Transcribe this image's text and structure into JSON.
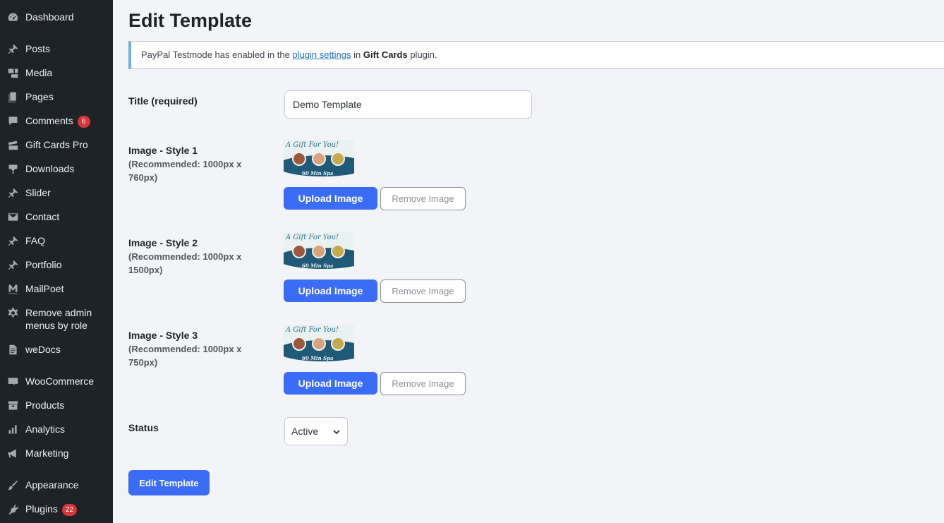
{
  "sidebar": {
    "items": [
      {
        "label": "Dashboard",
        "icon": "dashboard-icon"
      },
      {
        "label": "Posts",
        "icon": "pin-icon"
      },
      {
        "label": "Media",
        "icon": "media-icon"
      },
      {
        "label": "Pages",
        "icon": "pages-icon"
      },
      {
        "label": "Comments",
        "icon": "comment-icon",
        "badge": "6"
      },
      {
        "label": "Gift Cards Pro",
        "icon": "gift-cards-icon"
      },
      {
        "label": "Downloads",
        "icon": "download-icon"
      },
      {
        "label": "Slider",
        "icon": "pin-icon"
      },
      {
        "label": "Contact",
        "icon": "mail-icon"
      },
      {
        "label": "FAQ",
        "icon": "pin-icon"
      },
      {
        "label": "Portfolio",
        "icon": "pin-icon"
      },
      {
        "label": "MailPoet",
        "icon": "mailpoet-icon"
      },
      {
        "label": "Remove admin menus by role",
        "icon": "gear-icon"
      },
      {
        "label": "weDocs",
        "icon": "document-icon"
      },
      {
        "label": "WooCommerce",
        "icon": "woocommerce-icon"
      },
      {
        "label": "Products",
        "icon": "archive-icon"
      },
      {
        "label": "Analytics",
        "icon": "bar-chart-icon"
      },
      {
        "label": "Marketing",
        "icon": "megaphone-icon"
      },
      {
        "label": "Appearance",
        "icon": "brush-icon"
      },
      {
        "label": "Plugins",
        "icon": "plugin-icon",
        "badge": "22"
      }
    ]
  },
  "page": {
    "title": "Edit Template"
  },
  "notice": {
    "text_before": "PayPal Testmode has enabled in the ",
    "link": "plugin settings",
    "text_middle": " in ",
    "bold": "Gift Cards",
    "text_after": " plugin."
  },
  "form": {
    "title_label": "Title (required)",
    "title_value": "Demo Template",
    "images": [
      {
        "label": "Image - Style 1",
        "recommendation": "(Recommended: 1000px x 760px)"
      },
      {
        "label": "Image - Style 2",
        "recommendation": "(Recommended: 1000px x 1500px)"
      },
      {
        "label": "Image - Style 3",
        "recommendation": "(Recommended: 1000px x 750px)"
      }
    ],
    "thumb_script": "A Gift For You!",
    "thumb_caption": "60 Min Spa",
    "upload_label": "Upload Image",
    "remove_label": "Remove Image",
    "status_label": "Status",
    "status_value": "Active",
    "submit_label": "Edit Template"
  },
  "colors": {
    "sidebar_bg": "#1e2327",
    "primary": "#3b6cf5",
    "badge": "#d63638",
    "notice_accent": "#72aee6"
  }
}
